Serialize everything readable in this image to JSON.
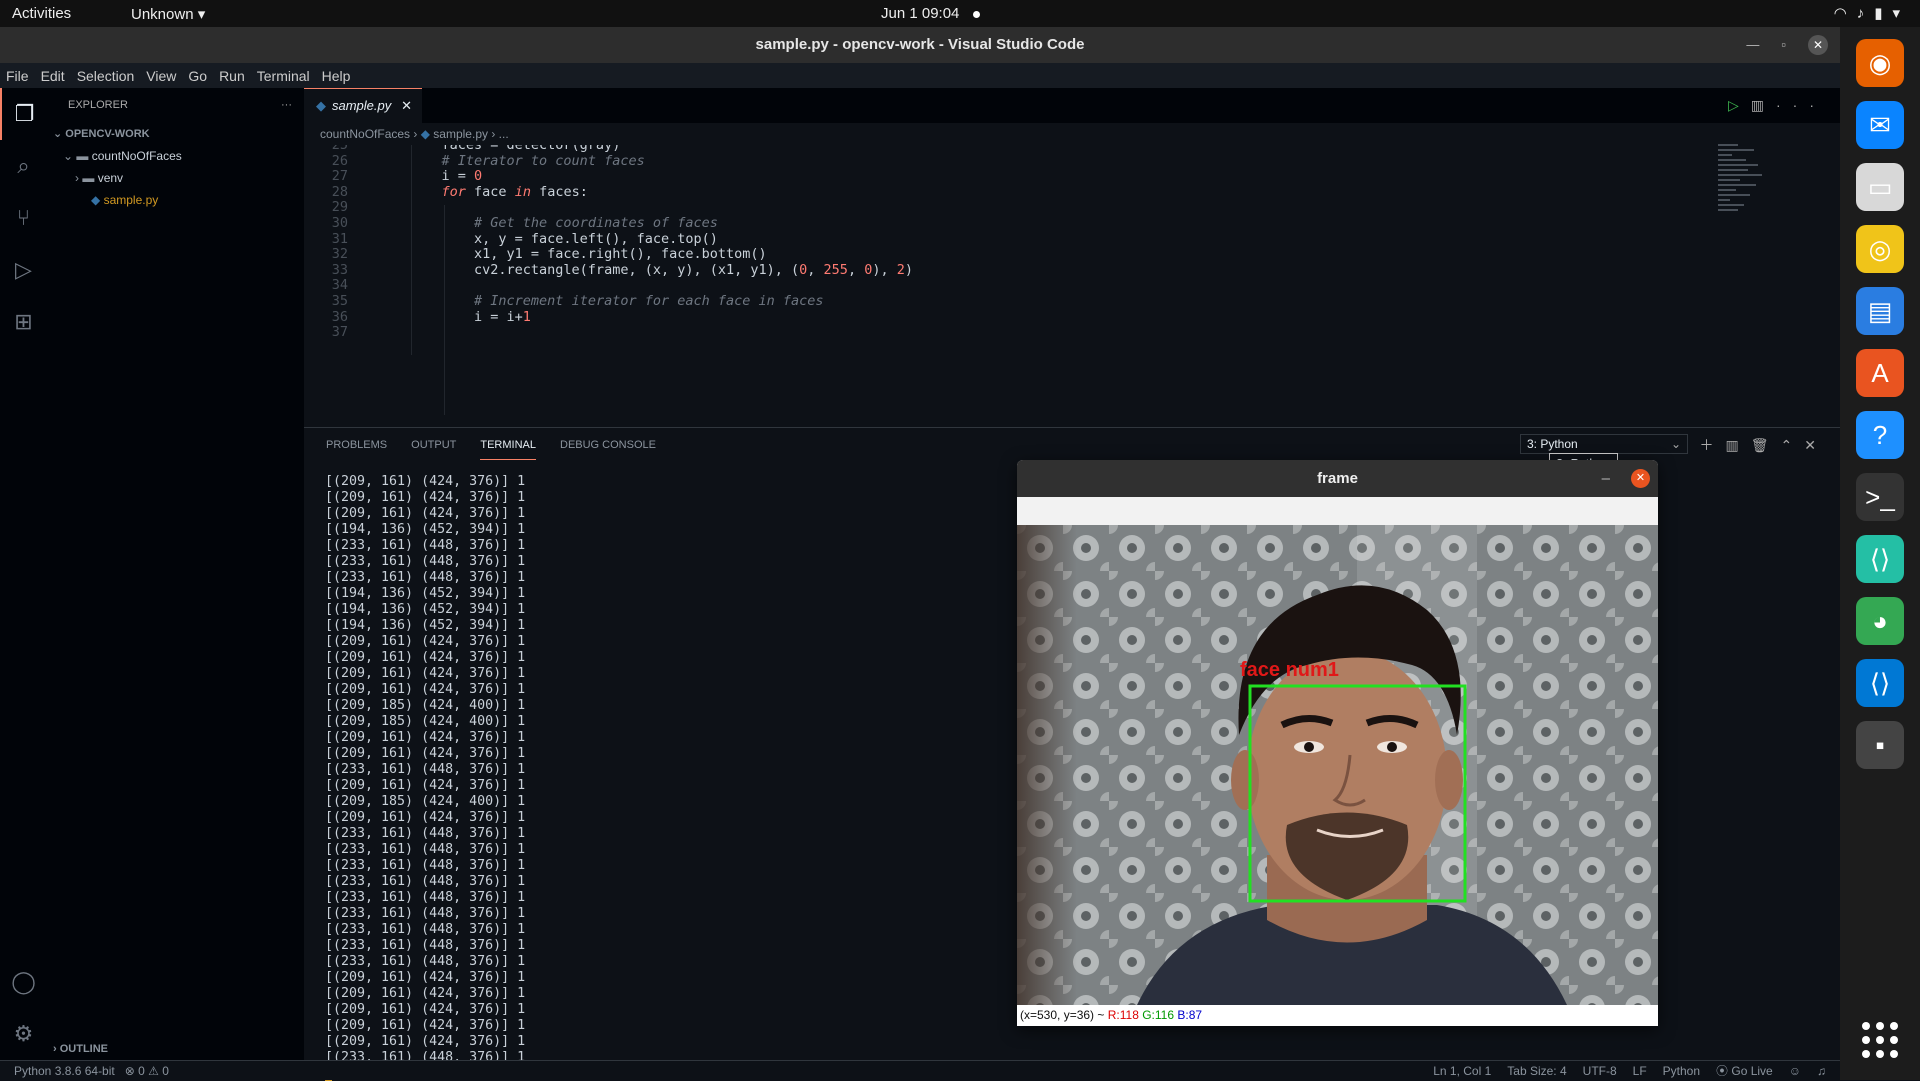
{
  "topbar": {
    "activities": "Activities",
    "app_menu": "Unknown ▾",
    "clock": "Jun 1  09:04"
  },
  "window": {
    "title": "sample.py - opencv-work - Visual Studio Code",
    "menu": [
      "File",
      "Edit",
      "Selection",
      "View",
      "Go",
      "Run",
      "Terminal",
      "Help"
    ]
  },
  "sidebar": {
    "header": "EXPLORER",
    "more": "···",
    "project": "OPENCV-WORK",
    "folder": "countNoOfFaces",
    "subfolder": "venv",
    "file": "sample.py",
    "outline": "OUTLINE"
  },
  "editor": {
    "tab_label": "sample.py",
    "tab_close": "✕",
    "breadcrumb_folder": "countNoOfFaces",
    "breadcrumb_file": "sample.py",
    "breadcrumb_more": "...",
    "lines": [
      {
        "n": "25",
        "html": "    faces = detector(gray)"
      },
      {
        "n": "26",
        "html": "    <span class=\"cmt\"># Iterator to count faces</span>"
      },
      {
        "n": "27",
        "html": "    i = <span class=\"num\">0</span>"
      },
      {
        "n": "28",
        "html": "    <span class=\"kw\">for</span> face <span class=\"kw\">in</span> faces:"
      },
      {
        "n": "29",
        "html": ""
      },
      {
        "n": "30",
        "html": "        <span class=\"cmt\"># Get the coordinates of faces</span>"
      },
      {
        "n": "31",
        "html": "        x, y = face.left(), face.top()"
      },
      {
        "n": "32",
        "html": "        x1, y1 = face.right(), face.bottom()"
      },
      {
        "n": "33",
        "html": "        cv2.rectangle(frame, (x, y), (x1, y1), (<span class=\"num\">0</span>, <span class=\"num\">255</span>, <span class=\"num\">0</span>), <span class=\"num\">2</span>)"
      },
      {
        "n": "34",
        "html": ""
      },
      {
        "n": "35",
        "html": "        <span class=\"cmt\"># Increment iterator for each face in faces</span>"
      },
      {
        "n": "36",
        "html": "        i = i+<span class=\"num\">1</span>"
      },
      {
        "n": "37",
        "html": ""
      }
    ]
  },
  "panel": {
    "tabs": [
      "PROBLEMS",
      "OUTPUT",
      "TERMINAL",
      "DEBUG CONSOLE"
    ],
    "active_tab": "TERMINAL",
    "terminal_select": "3: Python",
    "tooltip": "3: Python",
    "terminal_lines": [
      "[(209, 161) (424, 376)] 1",
      "[(209, 161) (424, 376)] 1",
      "[(209, 161) (424, 376)] 1",
      "[(194, 136) (452, 394)] 1",
      "[(233, 161) (448, 376)] 1",
      "[(233, 161) (448, 376)] 1",
      "[(233, 161) (448, 376)] 1",
      "[(194, 136) (452, 394)] 1",
      "[(194, 136) (452, 394)] 1",
      "[(194, 136) (452, 394)] 1",
      "[(209, 161) (424, 376)] 1",
      "[(209, 161) (424, 376)] 1",
      "[(209, 161) (424, 376)] 1",
      "[(209, 161) (424, 376)] 1",
      "[(209, 185) (424, 400)] 1",
      "[(209, 185) (424, 400)] 1",
      "[(209, 161) (424, 376)] 1",
      "[(209, 161) (424, 376)] 1",
      "[(233, 161) (448, 376)] 1",
      "[(209, 161) (424, 376)] 1",
      "[(209, 185) (424, 400)] 1",
      "[(209, 161) (424, 376)] 1",
      "[(233, 161) (448, 376)] 1",
      "[(233, 161) (448, 376)] 1",
      "[(233, 161) (448, 376)] 1",
      "[(233, 161) (448, 376)] 1",
      "[(233, 161) (448, 376)] 1",
      "[(233, 161) (448, 376)] 1",
      "[(233, 161) (448, 376)] 1",
      "[(233, 161) (448, 376)] 1",
      "[(233, 161) (448, 376)] 1",
      "[(209, 161) (424, 376)] 1",
      "[(209, 161) (424, 376)] 1",
      "[(209, 161) (424, 376)] 1",
      "[(209, 161) (424, 376)] 1",
      "[(209, 161) (424, 376)] 1",
      "[(233, 161) (448, 376)] 1"
    ]
  },
  "frame_window": {
    "title": "frame",
    "min": "–",
    "close": "✕",
    "face_label": "face num1",
    "status_prefix": "(x=530, y=36) ~ ",
    "status_r": "R:118",
    "status_g": "G:116",
    "status_b": "B:87"
  },
  "statusbar": {
    "interpreter": "Python 3.8.6 64-bit",
    "problems": "⊗ 0 ⚠ 0",
    "position": "Ln 1, Col 1",
    "tab_size": "Tab Size: 4",
    "encoding": "UTF-8",
    "eol": "LF",
    "language": "Python",
    "golive": "⦿ Go Live"
  },
  "dock": [
    {
      "name": "firefox-icon",
      "color": "#e66000"
    },
    {
      "name": "thunderbird-icon",
      "color": "#0a84ff"
    },
    {
      "name": "files-icon",
      "color": "#d8d8d8"
    },
    {
      "name": "rhythmbox-icon",
      "color": "#f0c419"
    },
    {
      "name": "writer-icon",
      "color": "#2a7de1"
    },
    {
      "name": "software-center-icon",
      "color": "#e95420"
    },
    {
      "name": "help-icon",
      "color": "#1e90ff"
    },
    {
      "name": "terminal-icon",
      "color": "#333333"
    },
    {
      "name": "vscode-insiders-icon",
      "color": "#24bfa5"
    },
    {
      "name": "chrome-icon",
      "color": "#34a853"
    },
    {
      "name": "vscode-icon",
      "color": "#0078d4"
    },
    {
      "name": "frame-window-icon",
      "color": "#444444"
    }
  ]
}
